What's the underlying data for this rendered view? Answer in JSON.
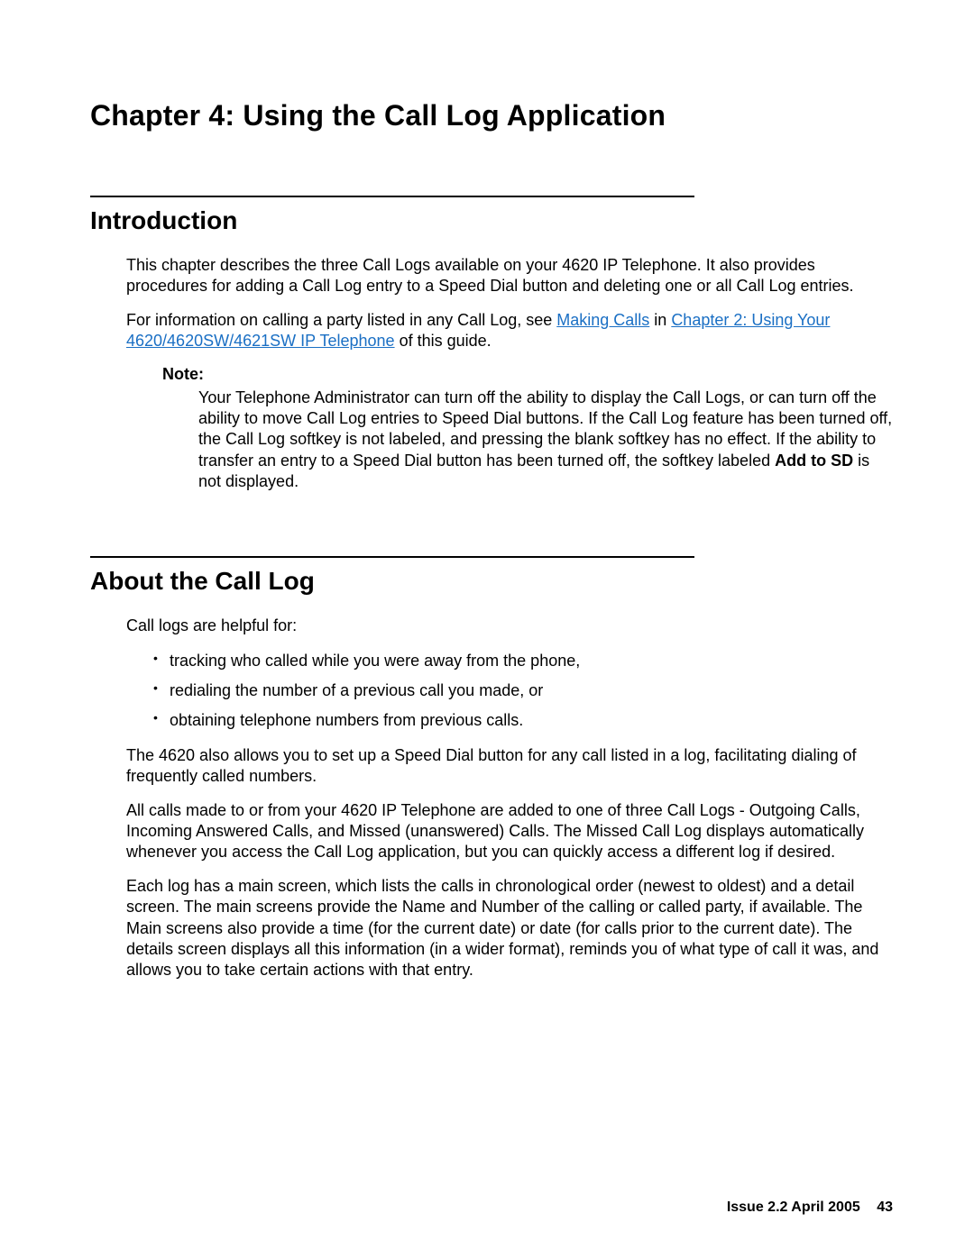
{
  "chapter": {
    "title": "Chapter 4:   Using the Call Log Application"
  },
  "introduction": {
    "heading": "Introduction",
    "para1": "This chapter describes the three Call Logs available on your 4620 IP Telephone. It also provides procedures for adding a Call Log entry to a Speed Dial button and deleting one or all Call Log entries.",
    "para2_prefix": "For information on calling a party listed in any Call Log, see ",
    "link_making_calls": "Making Calls",
    "para2_mid": " in ",
    "link_chapter2": "Chapter 2: Using Your 4620/4620SW/4621SW IP Telephone",
    "para2_suffix": " of this guide.",
    "note_label": "Note:",
    "note_text_1": "Your Telephone Administrator can turn off the ability to display the Call Logs, or can turn off the ability to move Call Log entries to Speed Dial buttons. If the Call Log feature has been turned off, the Call Log softkey is not labeled, and pressing the blank softkey has no effect. If the ability to transfer an entry to a Speed Dial button has been turned off, the softkey labeled ",
    "note_bold": "Add to SD",
    "note_text_2": " is not displayed."
  },
  "about": {
    "heading": "About the Call Log",
    "intro": "Call logs are helpful for:",
    "bullets": [
      "tracking who called while you were away from the phone,",
      "redialing the number of a previous call you made, or",
      "obtaining telephone numbers from previous calls."
    ],
    "para1": "The 4620 also allows you to set up a Speed Dial button for any call listed in a log, facilitating dialing of frequently called numbers.",
    "para2": "All calls made to or from your 4620 IP Telephone are added to one of three Call Logs - Outgoing Calls, Incoming Answered Calls, and Missed (unanswered) Calls. The Missed Call Log displays automatically whenever you access the Call Log application, but you can quickly access a different log if desired.",
    "para3": "Each log has a main screen, which lists the calls in chronological order (newest to oldest) and a detail screen. The main screens provide the Name and Number of the calling or called party, if available. The Main screens also provide a time (for the current date) or date (for calls prior to the current date). The details screen displays all this information (in a wider format), reminds you of what type of call it was, and allows you to take certain actions with that entry."
  },
  "footer": {
    "issue": "Issue 2.2   April 2005",
    "page": "43"
  }
}
